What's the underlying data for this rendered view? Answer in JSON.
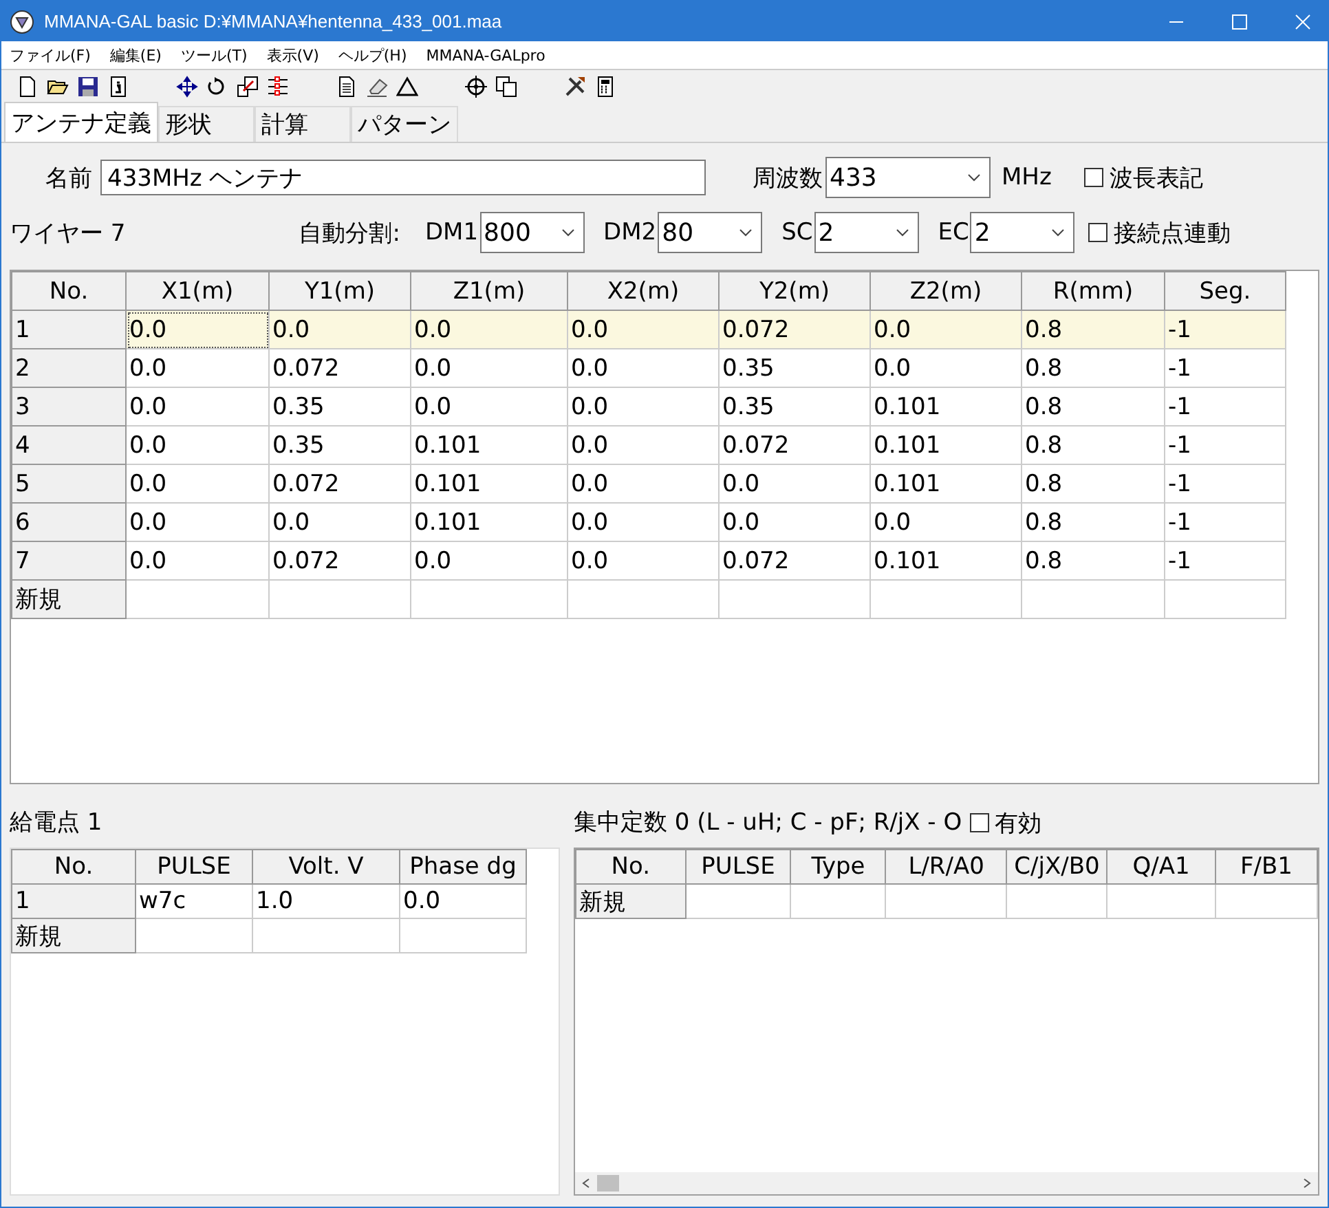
{
  "window": {
    "title": "MMANA-GAL basic  D:¥MMANA¥hentenna_433_001.maa"
  },
  "menu": [
    "ファイル(F)",
    "編集(E)",
    "ツール(T)",
    "表示(V)",
    "ヘルプ(H)",
    "MMANA-GALpro"
  ],
  "tabs": [
    {
      "label": "アンテナ定義",
      "selected": true
    },
    {
      "label": "形状",
      "selected": false
    },
    {
      "label": "計算",
      "selected": false
    },
    {
      "label": "パターン",
      "selected": false
    }
  ],
  "antenna": {
    "name_label": "名前",
    "name": "433MHz ヘンテナ",
    "freq_label": "周波数",
    "freq": "433",
    "freq_unit": "MHz",
    "wavelength": {
      "label": "波長表記",
      "checked": false
    }
  },
  "wires": {
    "label": "ワイヤー 7",
    "auto_label": "自動分割:",
    "dropdowns": [
      {
        "label": "DM1",
        "value": "800"
      },
      {
        "label": "DM2",
        "value": "80"
      },
      {
        "label": "SC",
        "value": "2"
      },
      {
        "label": "EC",
        "value": "2"
      }
    ],
    "link": {
      "label": "接続点連動",
      "checked": false
    },
    "columns": [
      "No.",
      "X1(m)",
      "Y1(m)",
      "Z1(m)",
      "X2(m)",
      "Y2(m)",
      "Z2(m)",
      "R(mm)",
      "Seg."
    ],
    "rows": [
      {
        "cells": [
          "1",
          "0.0",
          "0.0",
          "0.0",
          "0.0",
          "0.072",
          "0.0",
          "0.8",
          "-1"
        ],
        "selected": true
      },
      {
        "cells": [
          "2",
          "0.0",
          "0.072",
          "0.0",
          "0.0",
          "0.35",
          "0.0",
          "0.8",
          "-1"
        ],
        "selected": false
      },
      {
        "cells": [
          "3",
          "0.0",
          "0.35",
          "0.0",
          "0.0",
          "0.35",
          "0.101",
          "0.8",
          "-1"
        ],
        "selected": false
      },
      {
        "cells": [
          "4",
          "0.0",
          "0.35",
          "0.101",
          "0.0",
          "0.072",
          "0.101",
          "0.8",
          "-1"
        ],
        "selected": false
      },
      {
        "cells": [
          "5",
          "0.0",
          "0.072",
          "0.101",
          "0.0",
          "0.0",
          "0.101",
          "0.8",
          "-1"
        ],
        "selected": false
      },
      {
        "cells": [
          "6",
          "0.0",
          "0.0",
          "0.101",
          "0.0",
          "0.0",
          "0.0",
          "0.8",
          "-1"
        ],
        "selected": false
      },
      {
        "cells": [
          "7",
          "0.0",
          "0.072",
          "0.0",
          "0.0",
          "0.072",
          "0.101",
          "0.8",
          "-1"
        ],
        "selected": false
      }
    ],
    "new_row": "新規"
  },
  "feed": {
    "label": "給電点 1",
    "columns": [
      "No.",
      "PULSE",
      "Volt. V",
      "Phase dg"
    ],
    "rows": [
      {
        "cells": [
          "1",
          "w7c",
          "1.0",
          "0.0"
        ]
      }
    ],
    "new_row": "新規"
  },
  "lumped": {
    "label": "集中定数 0 (L - uH; C - pF; R/jX - O",
    "enabled": {
      "label": "有効",
      "checked": false
    },
    "columns": [
      "No.",
      "PULSE",
      "Type",
      "L/R/A0",
      "C/jX/B0",
      "Q/A1",
      "F/B1"
    ],
    "new_row": "新規"
  }
}
